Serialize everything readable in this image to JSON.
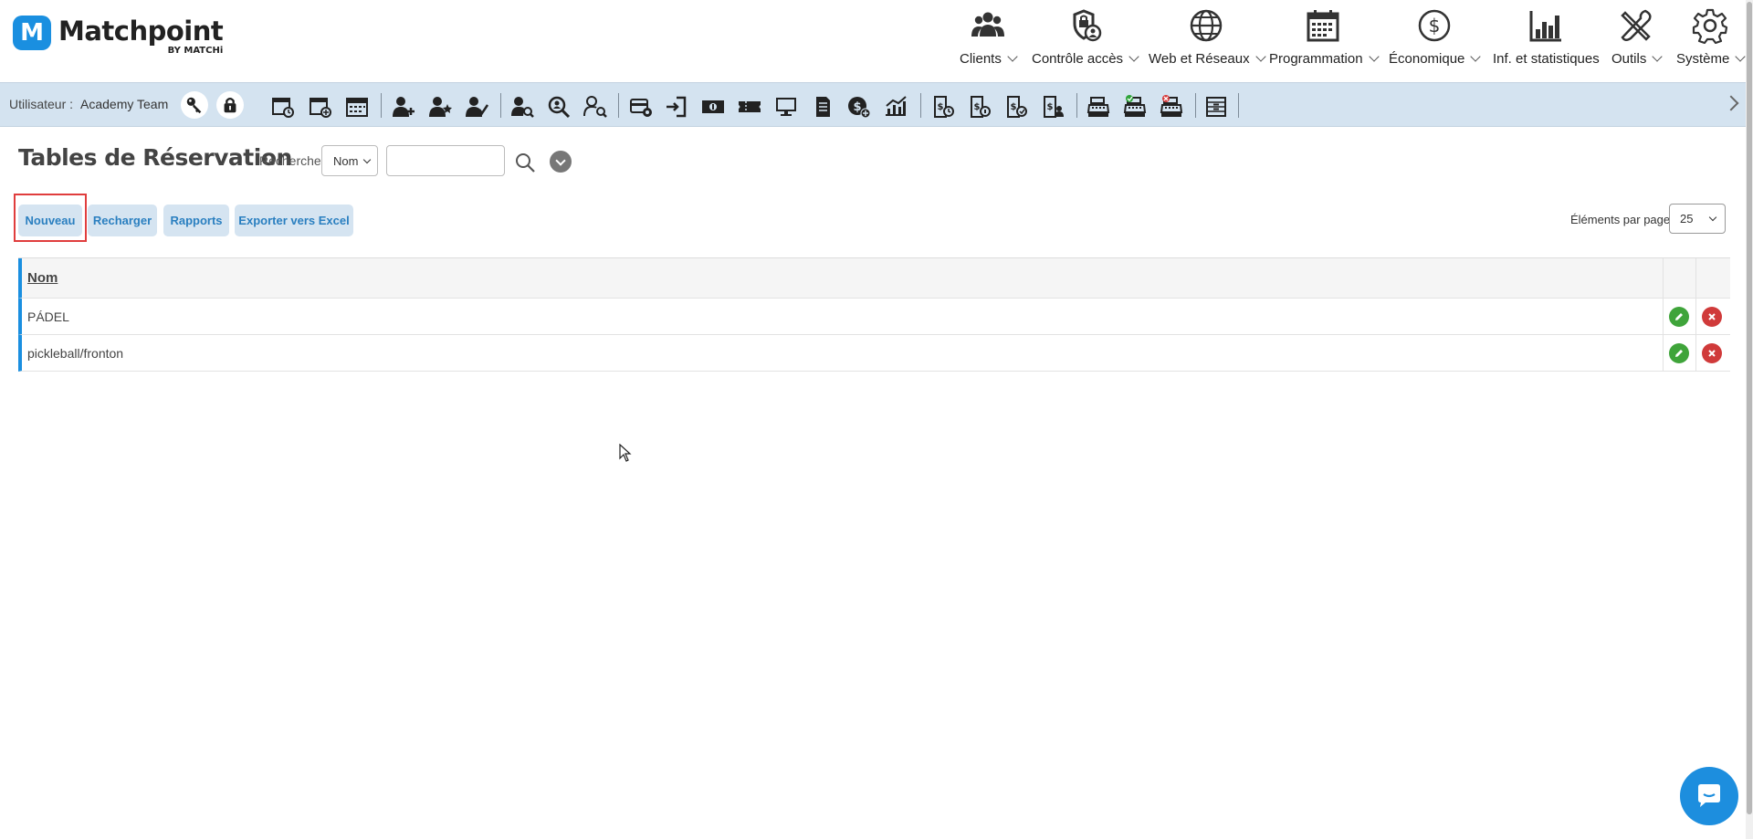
{
  "app": {
    "logo_letter": "M",
    "name": "Matchpoint",
    "byline": "BY MATCHi",
    "brand_color": "#1a8fe0"
  },
  "nav": {
    "items": [
      {
        "label": "Clients",
        "icon": "users-icon"
      },
      {
        "label": "Contrôle accès",
        "icon": "access-control-icon"
      },
      {
        "label": "Web et Réseaux",
        "icon": "globe-icon"
      },
      {
        "label": "Programmation",
        "icon": "calendar-icon"
      },
      {
        "label": "Économique",
        "icon": "dollar-icon"
      },
      {
        "label": "Inf. et statistiques",
        "icon": "bar-chart-icon"
      },
      {
        "label": "Outils",
        "icon": "tools-icon"
      },
      {
        "label": "Système",
        "icon": "gear-icon"
      }
    ]
  },
  "toolbar": {
    "user_label": "Utilisateur :",
    "user_name": "Academy Team"
  },
  "page": {
    "title": "Tables de Réservation",
    "search_label": "Recherche",
    "search_field": "Nom",
    "search_value": ""
  },
  "actions": {
    "new": "Nouveau",
    "reload": "Recharger",
    "reports": "Rapports",
    "export": "Exporter vers Excel"
  },
  "pagination": {
    "label": "Éléments par page",
    "value": "25"
  },
  "table": {
    "header": "Nom",
    "rows": [
      "PÁDEL",
      "pickleball/fronton"
    ]
  },
  "colors": {
    "toolbar_bg": "#d4e3f0",
    "button_bg": "#d5e4f1",
    "button_text": "#2a7fc0",
    "edit": "#3fa43a",
    "delete": "#d03a3a",
    "highlight": "#e03d3d"
  }
}
